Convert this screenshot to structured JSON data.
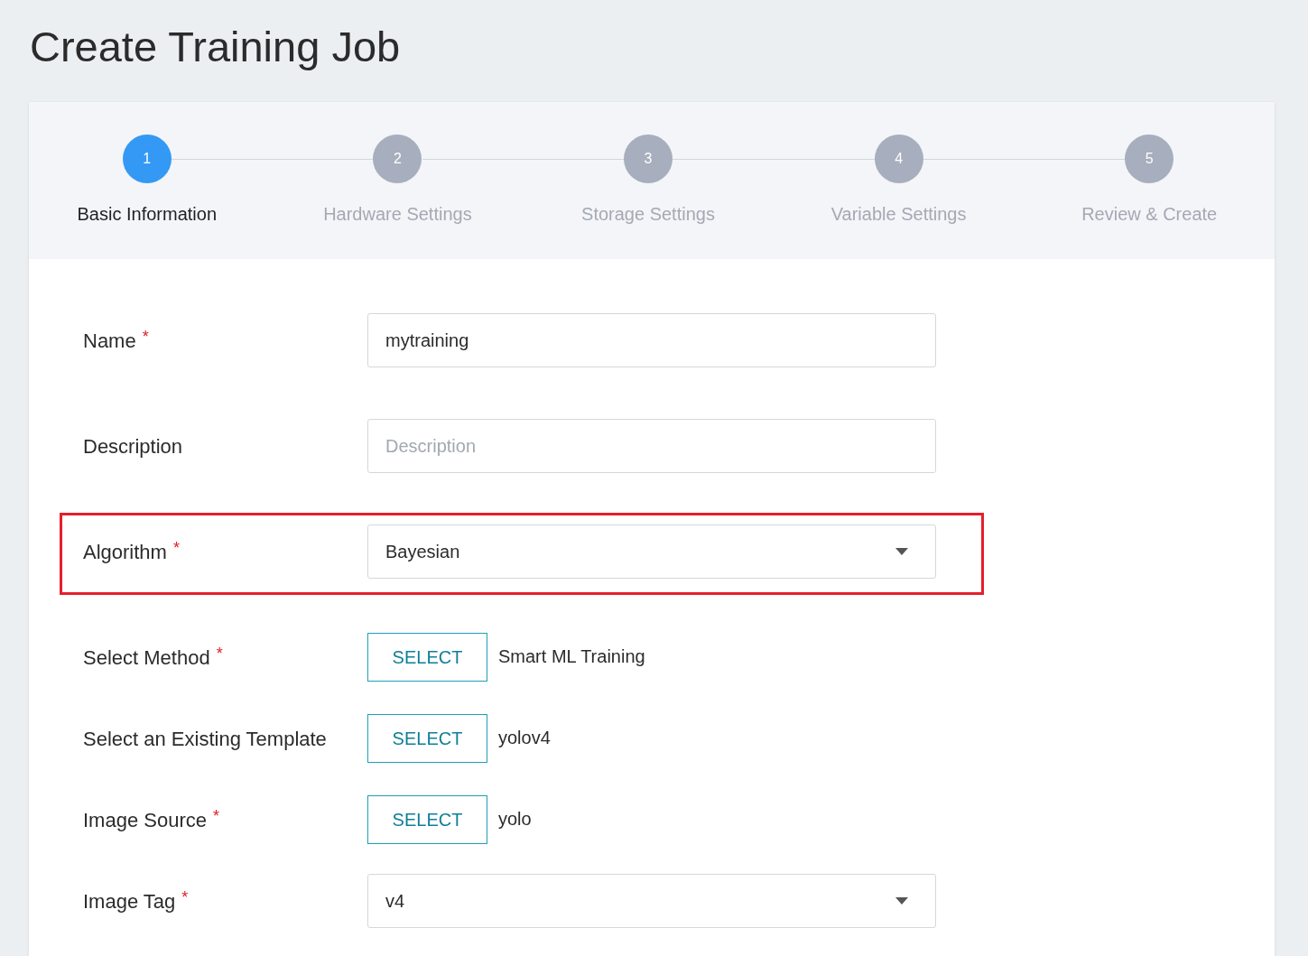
{
  "page": {
    "title": "Create Training Job"
  },
  "steps": [
    {
      "number": "1",
      "label": "Basic Information",
      "selected": true
    },
    {
      "number": "2",
      "label": "Hardware Settings",
      "selected": false
    },
    {
      "number": "3",
      "label": "Storage Settings",
      "selected": false
    },
    {
      "number": "4",
      "label": "Variable Settings",
      "selected": false
    },
    {
      "number": "5",
      "label": "Review & Create",
      "selected": false
    }
  ],
  "fields": [
    {
      "kind": "text",
      "label": "Name",
      "required_mark": "*",
      "value": "mytraining",
      "highlighted": false
    },
    {
      "kind": "text",
      "label": "Description",
      "placeholder": "Description",
      "highlighted": false
    },
    {
      "kind": "select",
      "label": "Algorithm",
      "required_mark": "*",
      "value": "Bayesian",
      "highlighted": true
    },
    {
      "kind": "picker",
      "label": "Select Method",
      "required_mark": "*",
      "button": "SELECT",
      "value": "Smart ML Training",
      "highlighted": false
    },
    {
      "kind": "picker",
      "label": "Select an Existing Template",
      "button": "SELECT",
      "value": "yolov4",
      "highlighted": false
    },
    {
      "kind": "picker",
      "label": "Image Source",
      "required_mark": "*",
      "button": "SELECT",
      "value": "yolo",
      "highlighted": false
    },
    {
      "kind": "select",
      "label": "Image Tag",
      "required_mark": "*",
      "value": "v4",
      "highlighted": false
    }
  ]
}
